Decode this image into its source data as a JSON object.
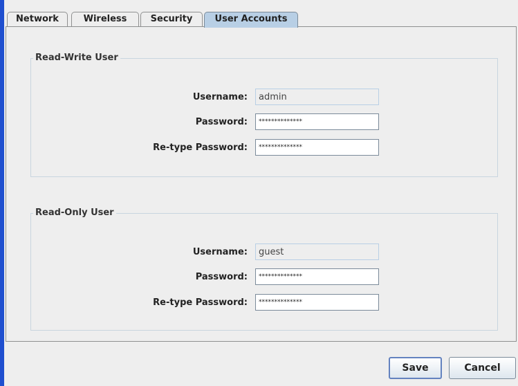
{
  "tabs": [
    {
      "label": "Network",
      "selected": false
    },
    {
      "label": "Wireless",
      "selected": false
    },
    {
      "label": "Security",
      "selected": false
    },
    {
      "label": "User Accounts",
      "selected": true
    }
  ],
  "read_write_group": {
    "title": "Read-Write User",
    "username_label": "Username:",
    "username_value": "admin",
    "password_label": "Password:",
    "password_value": "**************",
    "retype_label": "Re-type Password:",
    "retype_value": "**************"
  },
  "read_only_group": {
    "title": "Read-Only User",
    "username_label": "Username:",
    "username_value": "guest",
    "password_label": "Password:",
    "password_value": "**************",
    "retype_label": "Re-type Password:",
    "retype_value": "**************"
  },
  "buttons": {
    "save_label": "Save",
    "cancel_label": "Cancel"
  },
  "colors": {
    "window_edge": "#1f4fcf",
    "selected_tab": "#b8cfe5",
    "background": "#eeeeee"
  }
}
